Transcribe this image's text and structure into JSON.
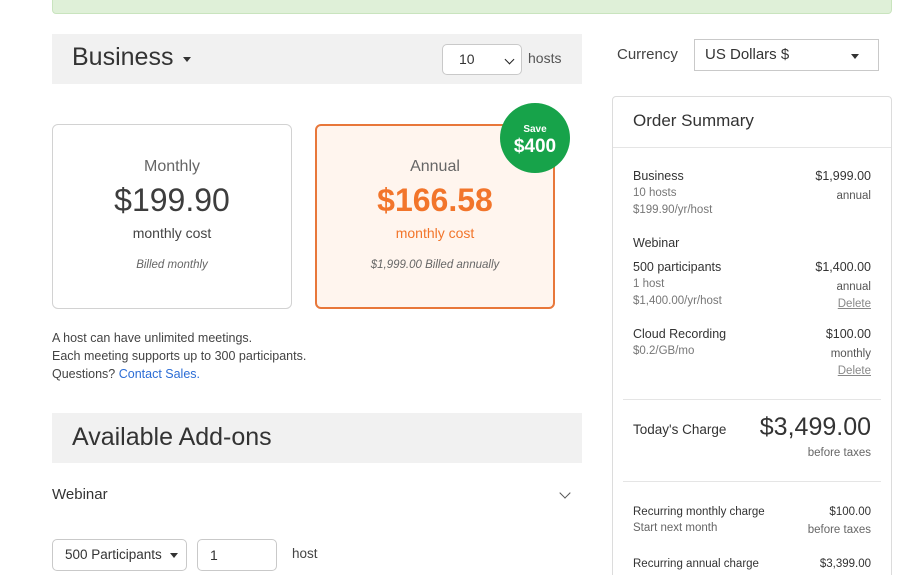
{
  "plan": {
    "name": "Business",
    "host_count": "10",
    "hosts_label": "hosts"
  },
  "cards": {
    "monthly": {
      "label": "Monthly",
      "price": "$199.90",
      "cost_label": "monthly cost",
      "billing": "Billed monthly"
    },
    "annual": {
      "label": "Annual",
      "price": "$166.58",
      "cost_label": "monthly cost",
      "billing": "$1,999.00 Billed annually"
    },
    "save_badge": {
      "word": "Save",
      "amount": "$400"
    }
  },
  "info": {
    "line1": "A host can have unlimited meetings.",
    "line2": "Each meeting supports up to 300 participants.",
    "questions": "Questions?",
    "contact_link": "Contact Sales."
  },
  "addons": {
    "title": "Available Add-ons",
    "webinar_label": "Webinar",
    "participants_option": "500 Participants",
    "host_count_value": "1",
    "host_unit": "host"
  },
  "currency": {
    "label": "Currency",
    "value": "US Dollars $"
  },
  "summary": {
    "title": "Order Summary",
    "business": {
      "name": "Business",
      "price": "$1,999.00",
      "hosts": "10 hosts",
      "period": "annual",
      "rate": "$199.90/yr/host"
    },
    "webinar": {
      "section": "Webinar",
      "name": "500 participants",
      "price": "$1,400.00",
      "hosts": "1 host",
      "period": "annual",
      "rate": "$1,400.00/yr/host",
      "delete": "Delete"
    },
    "cloud": {
      "name": "Cloud Recording",
      "price": "$100.00",
      "rate": "$0.2/GB/mo",
      "period": "monthly",
      "delete": "Delete"
    },
    "today": {
      "label": "Today's Charge",
      "amount": "$3,499.00",
      "note": "before taxes"
    },
    "recurring_monthly": {
      "label": "Recurring monthly charge",
      "amount": "$100.00",
      "start": "Start next month",
      "note": "before taxes"
    },
    "recurring_annual": {
      "label": "Recurring annual charge",
      "amount": "$3,399.00"
    }
  },
  "colors": {
    "accent_orange": "#f2752b",
    "save_green": "#17a34a",
    "link_blue": "#2c6dd5",
    "banner_green": "#dff0d8"
  }
}
